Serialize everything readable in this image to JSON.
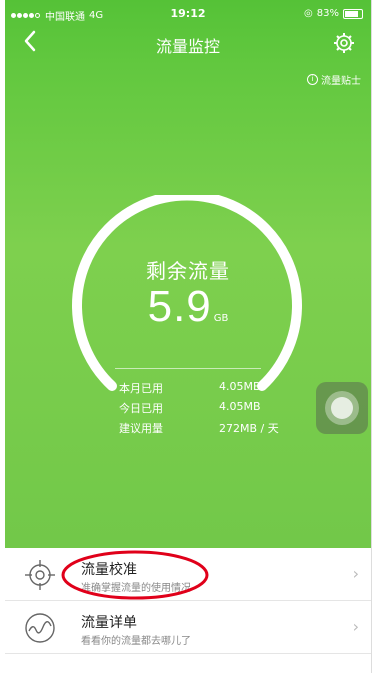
{
  "status": {
    "carrier": "中国联通",
    "network": "4G",
    "time": "19:12",
    "battery": "83%"
  },
  "nav": {
    "title": "流量监控"
  },
  "tips": {
    "label": "流量贴士"
  },
  "gauge": {
    "label": "剩余流量",
    "value": "5.9",
    "unit": "GB",
    "progress": 0.7
  },
  "stats": [
    {
      "label": "本月已用",
      "value": "4.05MB"
    },
    {
      "label": "今日已用",
      "value": "4.05MB"
    },
    {
      "label": "建议用量",
      "value": "272MB / 天"
    }
  ],
  "list": [
    {
      "title": "流量校准",
      "subtitle": "准确掌握流量的使用情况",
      "icon": "target-icon"
    },
    {
      "title": "流量详单",
      "subtitle": "看看你的流量都去哪儿了",
      "icon": "wave-chart-icon"
    }
  ],
  "colors": {
    "green_top": "#55c237",
    "green_mid": "#7ed04e",
    "annotation": "#e0001a"
  }
}
